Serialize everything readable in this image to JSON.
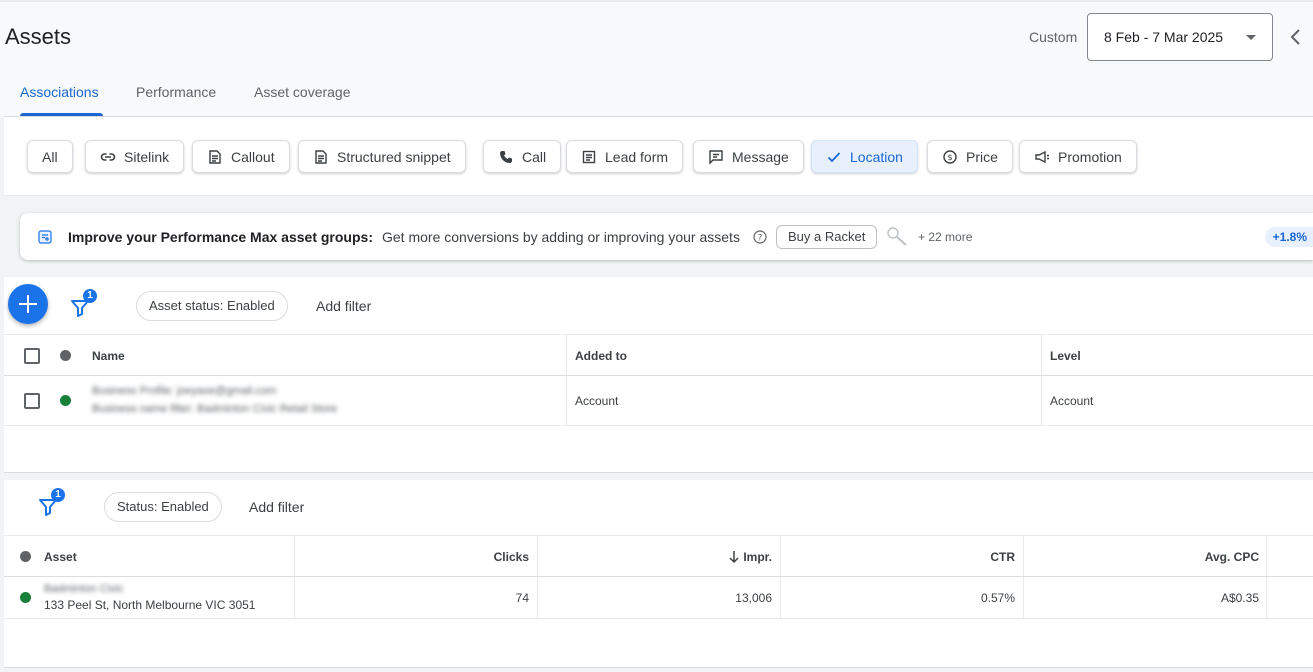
{
  "header": {
    "title": "Assets",
    "date_range_label": "Custom",
    "date_range_value": "8 Feb - 7 Mar 2025",
    "tabs": [
      {
        "label": "Associations",
        "active": true
      },
      {
        "label": "Performance",
        "active": false
      },
      {
        "label": "Asset coverage",
        "active": false
      }
    ]
  },
  "asset_type_chips": [
    {
      "label": "All",
      "icon": "none",
      "selected": false
    },
    {
      "label": "Sitelink",
      "icon": "link-icon",
      "selected": false
    },
    {
      "label": "Callout",
      "icon": "callout-icon",
      "selected": false
    },
    {
      "label": "Structured snippet",
      "icon": "snippet-icon",
      "selected": false
    },
    {
      "label": "Call",
      "icon": "phone-icon",
      "selected": false
    },
    {
      "label": "Lead form",
      "icon": "form-icon",
      "selected": false
    },
    {
      "label": "Message",
      "icon": "message-icon",
      "selected": false
    },
    {
      "label": "Location",
      "icon": "check-icon",
      "selected": true
    },
    {
      "label": "Price",
      "icon": "price-icon",
      "selected": false
    },
    {
      "label": "Promotion",
      "icon": "promotion-icon",
      "selected": false
    }
  ],
  "banner": {
    "title": "Improve your Performance Max asset groups:",
    "text": "Get more conversions by adding or improving your assets",
    "suggestion": "Buy a Racket",
    "more": "+ 22 more",
    "uplift": "+1.8%"
  },
  "associations_table": {
    "filter_count": "1",
    "filter_pill": "Asset status: Enabled",
    "add_filter": "Add filter",
    "columns": {
      "name": "Name",
      "added_to": "Added to",
      "level": "Level"
    },
    "rows": [
      {
        "status_color": "#188038",
        "name_line1": "Business Profile: joeyaxe@gmail.com",
        "name_line2": "Business name filter: Badminton Civic Retail Store",
        "added_to": "Account",
        "level": "Account"
      }
    ]
  },
  "performance_table": {
    "filter_count": "1",
    "filter_pill": "Status: Enabled",
    "add_filter": "Add filter",
    "columns": {
      "asset": "Asset",
      "clicks": "Clicks",
      "impr": "Impr.",
      "ctr": "CTR",
      "avg_cpc": "Avg. CPC"
    },
    "rows": [
      {
        "status_color": "#188038",
        "asset_line1": "Badminton Civic",
        "asset_line2": "133 Peel St, North Melbourne VIC 3051",
        "clicks": "74",
        "impr": "13,006",
        "ctr": "0.57%",
        "avg_cpc": "A$0.35"
      }
    ]
  },
  "colors": {
    "accent": "#1a73e8",
    "active_tab": "#1967d2",
    "status_enabled": "#188038",
    "status_header": "#5f6368"
  }
}
